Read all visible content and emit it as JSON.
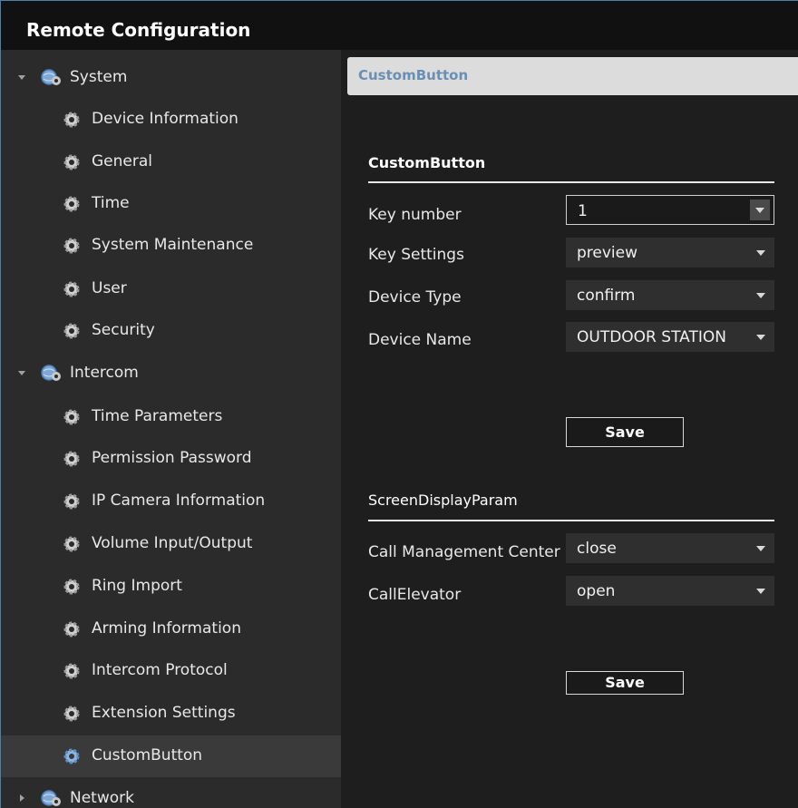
{
  "window": {
    "title": "Remote Configuration"
  },
  "sidebar": {
    "groups": [
      {
        "label": "System",
        "icon": "gear-globe-icon",
        "expanded": true,
        "children": [
          "Device Information",
          "General",
          "Time",
          "System Maintenance",
          "User",
          "Security"
        ]
      },
      {
        "label": "Intercom",
        "icon": "gear-globe-icon",
        "expanded": true,
        "children": [
          "Time Parameters",
          "Permission Password",
          "IP Camera Information",
          "Volume Input/Output",
          "Ring Import",
          "Arming Information",
          "Intercom Protocol",
          "Extension Settings",
          "CustomButton"
        ]
      },
      {
        "label": "Network",
        "icon": "gear-globe-icon",
        "expanded": false,
        "children": []
      }
    ],
    "selected": "CustomButton"
  },
  "panel": {
    "header": "CustomButton",
    "section1": {
      "title": "CustomButton",
      "fields": [
        {
          "label": "Key number",
          "value": "1"
        },
        {
          "label": "Key Settings",
          "value": "preview"
        },
        {
          "label": "Device Type",
          "value": "confirm"
        },
        {
          "label": "Device Name",
          "value": "OUTDOOR STATION"
        }
      ],
      "save_label": "Save"
    },
    "section2": {
      "title": "ScreenDisplayParam",
      "fields": [
        {
          "label": "Call Management Center",
          "value": "close"
        },
        {
          "label": "CallElevator",
          "value": "open"
        }
      ],
      "save_label": "Save"
    }
  },
  "colors": {
    "sidebar_bg": "#2b2b2b",
    "content_bg": "#1e1e1e",
    "header_accent": "#6a8fb5",
    "icon_blue": "#5b8ec9"
  }
}
